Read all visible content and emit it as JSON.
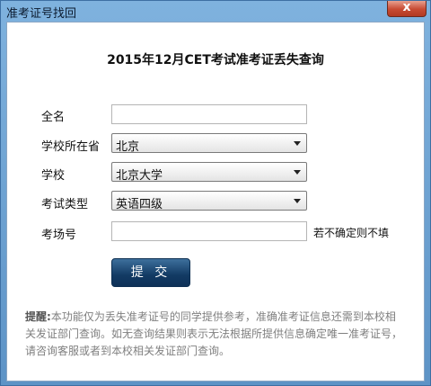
{
  "window": {
    "title": "准考证号找回",
    "close_glyph": "x"
  },
  "form": {
    "heading": "2015年12月CET考试准考证丢失查询",
    "fields": {
      "fullname": {
        "label": "全名",
        "value": ""
      },
      "province": {
        "label": "学校所在省",
        "value": "北京"
      },
      "school": {
        "label": "学校",
        "value": "北京大学"
      },
      "exam_type": {
        "label": "考试类型",
        "value": "英语四级"
      },
      "room_no": {
        "label": "考场号",
        "value": "",
        "hint": "若不确定则不填"
      }
    },
    "submit_label": "提 交"
  },
  "notice": {
    "label": "提醒:",
    "text": "本功能仅为丢失准考证号的同学提供参考，准确准考证信息还需到本校相关发证部门查询。如无查询结果则表示无法根据所提供信息确定唯一准考证号，请咨询客服或者到本校相关发证部门查询。"
  }
}
